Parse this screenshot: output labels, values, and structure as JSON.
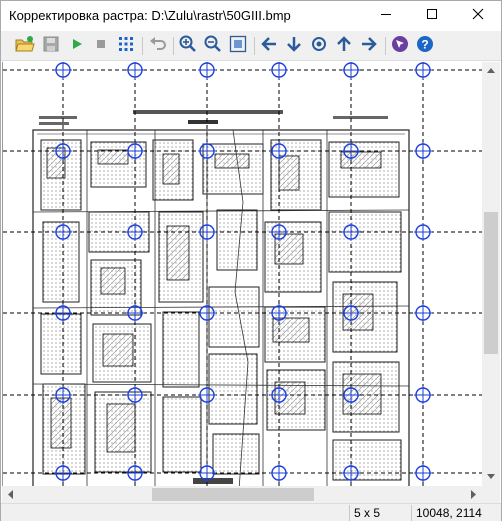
{
  "window": {
    "title": "Корректировка растра: D:\\Zulu\\rastr\\50GIII.bmp"
  },
  "window_controls": [
    "minimize-icon",
    "maximize-icon",
    "close-icon"
  ],
  "toolbar": {
    "buttons": [
      "open-folder-icon",
      "save-icon",
      "play-icon",
      "stop-icon",
      "grid-icon",
      "undo-icon",
      "zoom-in-icon",
      "zoom-out-icon",
      "zoom-fit-icon",
      "arrow-left-icon",
      "arrow-down-icon",
      "center-point-icon",
      "arrow-up-icon",
      "arrow-right-icon",
      "cursor-icon",
      "help-icon"
    ]
  },
  "status": {
    "grid_size": "5 x 5",
    "coordinates": "10048, 2114"
  },
  "colors": {
    "accent_blue": "#1a66cc",
    "control_point_blue": "#1e3fd6",
    "toolbar_green": "#2faa4a",
    "help_blue": "#1c66c8",
    "cursor_purple": "#6a3fa0"
  }
}
